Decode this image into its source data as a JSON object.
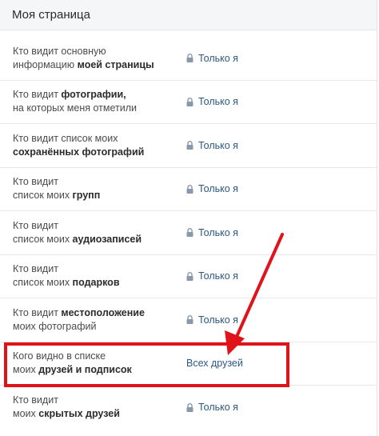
{
  "header": {
    "title": "Моя страница"
  },
  "rows": [
    {
      "line1": "Кто видит основную",
      "line2_pre": "информацию ",
      "line2_bold": "моей страницы",
      "value": "Только я",
      "locked": true
    },
    {
      "line1_pre": "Кто видит ",
      "line1_bold": "фотографии,",
      "line2": "на которых меня отметили",
      "value": "Только я",
      "locked": true
    },
    {
      "line1": "Кто видит список моих",
      "line2_bold": "сохранённых фотографий",
      "value": "Только я",
      "locked": true
    },
    {
      "line1": "Кто видит",
      "line2_pre": "список моих ",
      "line2_bold": "групп",
      "value": "Только я",
      "locked": true
    },
    {
      "line1": "Кто видит",
      "line2_pre": "список моих ",
      "line2_bold": "аудиозаписей",
      "value": "Только я",
      "locked": true
    },
    {
      "line1": "Кто видит",
      "line2_pre": "список моих ",
      "line2_bold": "подарков",
      "value": "Только я",
      "locked": true
    },
    {
      "line1_pre": "Кто видит ",
      "line1_bold": "местоположение",
      "line2": "моих фотографий",
      "value": "Только я",
      "locked": true
    },
    {
      "line1": "Кого видно в списке",
      "line2_pre": "моих ",
      "line2_bold": "друзей и подписок",
      "value": "Всех друзей",
      "locked": false
    },
    {
      "line1": "Кто видит",
      "line2_pre": "моих ",
      "line2_bold": "скрытых друзей",
      "value": "Только я",
      "locked": true
    }
  ],
  "colors": {
    "accent": "#2a5885",
    "lock": "#8a98ab",
    "highlight": "#e0131b"
  }
}
